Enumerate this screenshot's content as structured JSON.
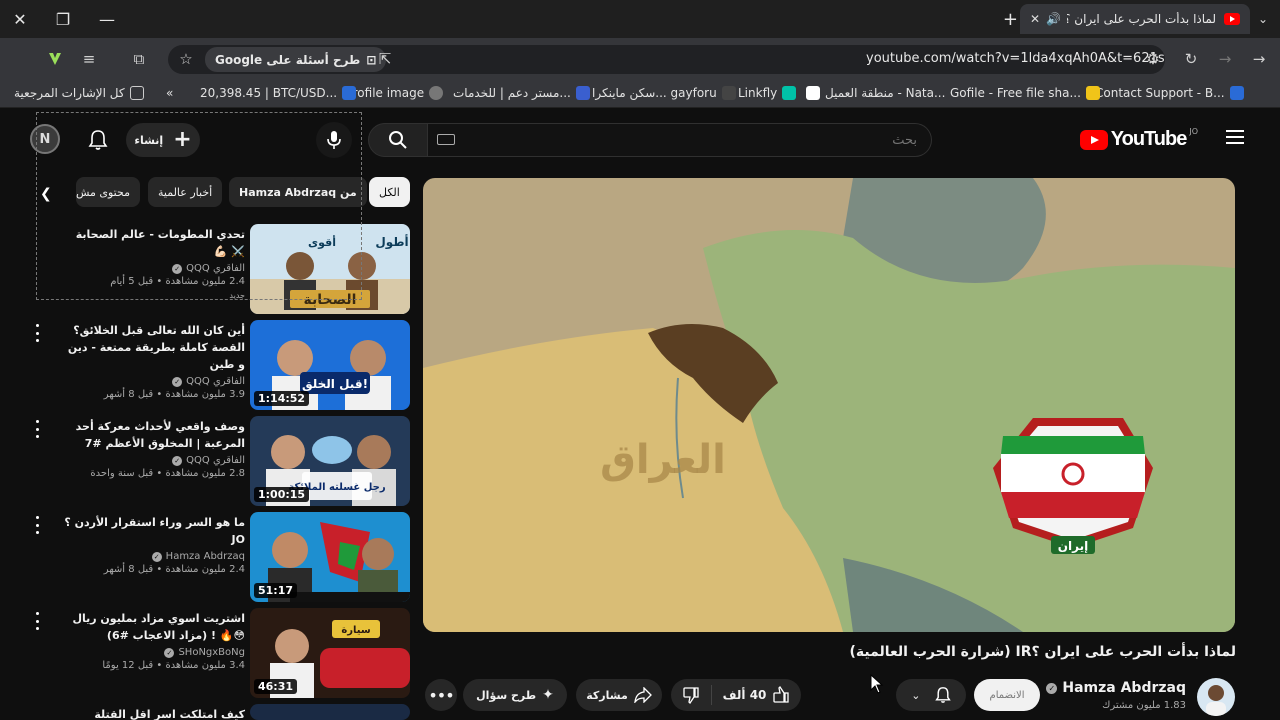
{
  "browser": {
    "tab_title": "لماذا بدأت الحرب على ايران ؟IR",
    "url": "youtube.com/watch?v=1lda4xqAh0A&t=621s",
    "omnibox_question": "طرح أسئلة على Google",
    "bookmarks": [
      "Contact Support - B...",
      "Gofile - Free file sha...",
      "منطقة العميل - Nata...",
      "Linkfly",
      "سكن ماينكرا... gayforu",
      "مستر دعم | للخدمات...",
      "profile image",
      "20,398.45 | BTC/USD...",
      "كل الإشارات المرجعية"
    ]
  },
  "masthead": {
    "logo_text": "YouTube",
    "country_code": "JO",
    "search_placeholder": "بحث",
    "create_label": "إنشاء",
    "avatar_letter": "N"
  },
  "chips": [
    "الكل",
    "من Hamza Abdrzaq",
    "أخبار عالمية",
    "محتوى مش"
  ],
  "video": {
    "title": "لماذا بدأت الحرب على ايران ؟IR (شرارة الحرب العالمية)",
    "map_label_iraq": "العراق",
    "map_label_iran": "إيران",
    "channel_name": "Hamza Abdrzaq",
    "subscribers": "1.83 مليون مشترك",
    "join_label": "الانضمام",
    "likes": "40 ألف",
    "share_label": "مشاركة",
    "ask_label": "طرح سؤال"
  },
  "recommendations": [
    {
      "title": "تحدي المطومات - عالم الصحابة ⚔️ 💪🏻",
      "channel": "الفاقري QQQ",
      "meta": "2.4 مليون مشاهدة • قبل 5 أيام",
      "badge": "جديد",
      "thumb_text": "أطول",
      "thumb_text2": "أقوى",
      "thumb_text3": "الصحابة",
      "duration": ""
    },
    {
      "title": "أين كان الله تعالى قبل الخلائق؟ القصة كاملة بطريقة ممتعة - دين و طين",
      "channel": "الفاقري QQQ",
      "meta": "3.9 مليون مشاهدة • قبل 8 أشهر",
      "thumb_text": "قبل الخلق!",
      "duration": "1:14:52"
    },
    {
      "title": "وصف واقعي لأحداث معركة أحد المرعبة | المخلوق الأعظم #7",
      "channel": "الفاقري QQQ",
      "meta": "2.8 مليون مشاهدة • قبل سنة واحدة",
      "thumb_text": "رجل غسلته الملائكة",
      "duration": "1:00:15"
    },
    {
      "title": "ما هو السر وراء استقرار الأردن ؟JO",
      "channel": "Hamza Abdrzaq",
      "meta": "2.4 مليون مشاهدة • قبل 8 أشهر",
      "duration": "51:17"
    },
    {
      "title": "اشتريت اسوي مزاد بمليون ريال 😳🔥 ! (مزاد الاعجاب #6)",
      "channel": "SHoNgxBoNg",
      "meta": "3.4 مليون مشاهدة • قبل 12 يومًا",
      "thumb_text": "سيارة",
      "duration": "46:31"
    },
    {
      "title": "كيف امتلكت اسر اقل القتلة الدولية ؟ (شكل",
      "channel": "",
      "meta": ""
    }
  ],
  "colors": {
    "brand_red": "#ff0000",
    "background": "#0f0f0f",
    "chip_bg": "#272727"
  }
}
